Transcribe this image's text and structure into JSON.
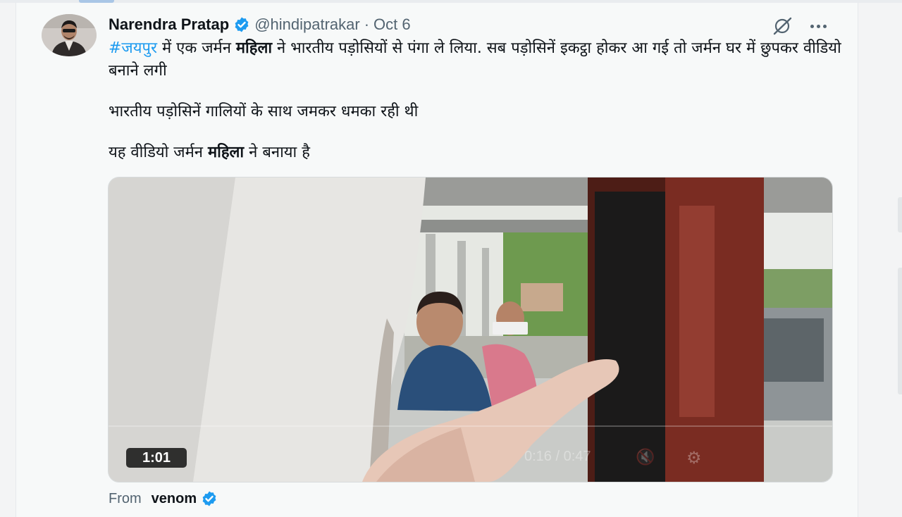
{
  "post": {
    "author_name": "Narendra Pratap",
    "handle": "@hindipatrakar",
    "separator": "·",
    "date": "Oct 6",
    "text": {
      "hashtag": "#जयपुर",
      "line1_a": " में एक जर्मन ",
      "line1_bold": "महिला",
      "line1_b": " ने भारतीय पड़ोसियों से पंगा ले लिया. सब पड़ोसिनें इकट्ठा होकर आ गई तो जर्मन घर में छुपकर वीडियो बनाने लगी",
      "para2": "भारतीय पड़ोसिनें गालियों के साथ जमकर धमका रही थी",
      "para3_a": "यह वीडियो जर्मन ",
      "para3_bold": "महिला",
      "para3_b": " ने बनाया है"
    },
    "media": {
      "duration": "1:01",
      "overlay_time": "0:16 / 0:47",
      "overlay_mute_glyph": "🔇",
      "overlay_settings_glyph": "⚙"
    },
    "footer": {
      "from_label": "From",
      "source_name": "venom"
    }
  },
  "icons": {
    "verified": "verified-badge-icon",
    "grok": "grok-icon",
    "more": "more-options-icon"
  },
  "colors": {
    "accent": "#1d9bf0",
    "muted": "#536471",
    "text": "#0f1419"
  }
}
